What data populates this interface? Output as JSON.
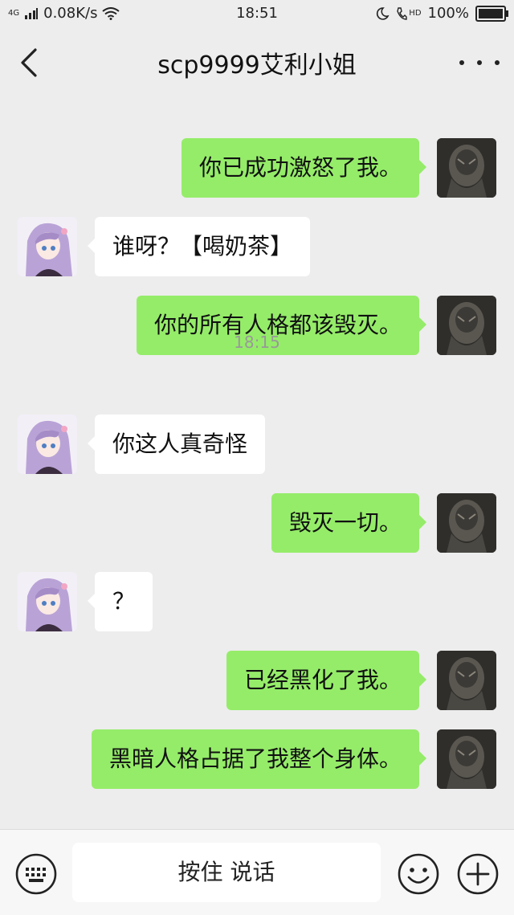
{
  "status_bar": {
    "network": "4G",
    "speed": "0.08K/s",
    "time": "18:51",
    "hd_label": "HD",
    "battery": "100%",
    "battery_level": 1.0
  },
  "header": {
    "title": "scp9999艾利小姐"
  },
  "chat": {
    "messages": [
      {
        "text": "你已成功激怒了我。",
        "sender": "me"
      },
      {
        "text": "谁呀？【喝奶茶】",
        "sender": "other"
      },
      {
        "text": "你的所有人格都该毁灭。",
        "sender": "me"
      },
      {
        "timestamp": "18:15"
      },
      {
        "text": "你这人真奇怪",
        "sender": "other"
      },
      {
        "text": "毁灭一切。",
        "sender": "me"
      },
      {
        "text": "？",
        "sender": "other"
      },
      {
        "text": "已经黑化了我。",
        "sender": "me"
      },
      {
        "text": "黑暗人格占据了我整个身体。",
        "sender": "me"
      }
    ]
  },
  "input_bar": {
    "voice_label": "按住 说话"
  },
  "colors": {
    "background": "#ededed",
    "my_bubble": "#95ec69",
    "other_bubble": "#ffffff",
    "timestamp": "#999999"
  },
  "icons": [
    "back-arrow-icon",
    "more-dots-icon",
    "keyboard-icon",
    "emoji-icon",
    "plus-icon",
    "wifi-icon",
    "signal-icon",
    "moon-icon",
    "phone-hd-icon",
    "battery-icon"
  ]
}
